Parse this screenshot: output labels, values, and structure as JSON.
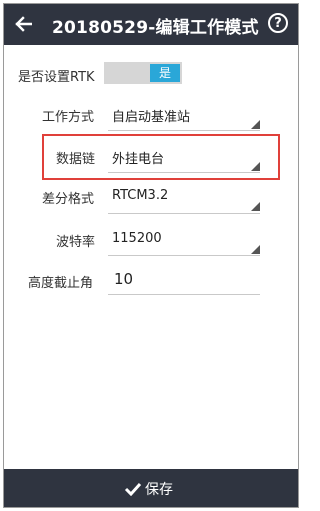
{
  "header": {
    "back_icon": "back-arrow-icon",
    "title": "20180529-编辑工作模式",
    "help_label": "?",
    "help_icon": "help-circle-icon"
  },
  "form": {
    "rtk": {
      "label": "是否设置RTK",
      "toggle_value": "是",
      "enabled": true
    },
    "work_mode": {
      "label": "工作方式",
      "value": "自启动基准站"
    },
    "data_link": {
      "label": "数据链",
      "value": "外挂电台",
      "highlighted": true,
      "highlight_color": "#e0403a"
    },
    "diff_format": {
      "label": "差分格式",
      "value": "RTCM3.2"
    },
    "baud_rate": {
      "label": "波特率",
      "value": "115200"
    },
    "cutoff_angle": {
      "label": "高度截止角",
      "value": "10"
    }
  },
  "footer": {
    "save_label": "保存",
    "save_icon": "check-icon"
  },
  "colors": {
    "bar": "#2f3440",
    "toggle_on": "#2aa7d8",
    "highlight": "#e0403a"
  }
}
